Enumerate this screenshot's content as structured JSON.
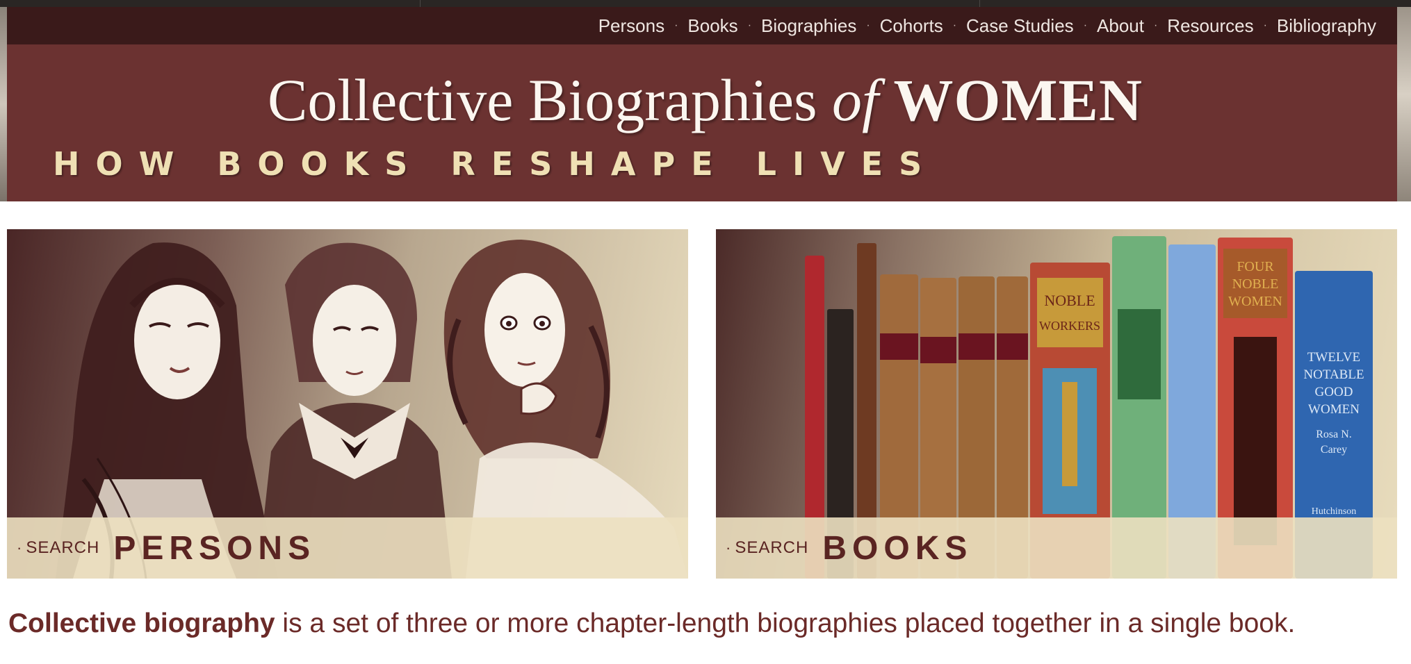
{
  "nav": {
    "items": [
      {
        "label": "Persons"
      },
      {
        "label": "Books"
      },
      {
        "label": "Biographies"
      },
      {
        "label": "Cohorts"
      },
      {
        "label": "Case Studies"
      },
      {
        "label": "About"
      },
      {
        "label": "Resources"
      },
      {
        "label": "Bibliography"
      }
    ],
    "separator": "·"
  },
  "banner": {
    "title_main": "Collective Biographies",
    "title_of": "of",
    "title_women": "WOMEN",
    "tagline": "HOW BOOKS RESHAPE LIVES"
  },
  "panels": {
    "persons": {
      "bullet": "·",
      "search_label": "SEARCH",
      "target": "PERSONS"
    },
    "books": {
      "bullet": "·",
      "search_label": "SEARCH",
      "target": "BOOKS",
      "spine_titles": {
        "noble_workers": "NOBLE WORKERS",
        "four_noble_women": "FOUR NOBLE WOMEN",
        "twelve_notable": "TWELVE NOTABLE GOOD WOMEN",
        "author": "Rosa N. Carey",
        "publisher": "Hutchinson"
      }
    }
  },
  "definition": {
    "term": "Collective biography",
    "text": " is a set of three or more chapter-length biographies placed together in a single book."
  },
  "colors": {
    "nav_bg": "#3a1a1a",
    "banner_bg": "#6b3231",
    "tagline": "#efe0b4",
    "accent_text": "#6b2a28"
  }
}
